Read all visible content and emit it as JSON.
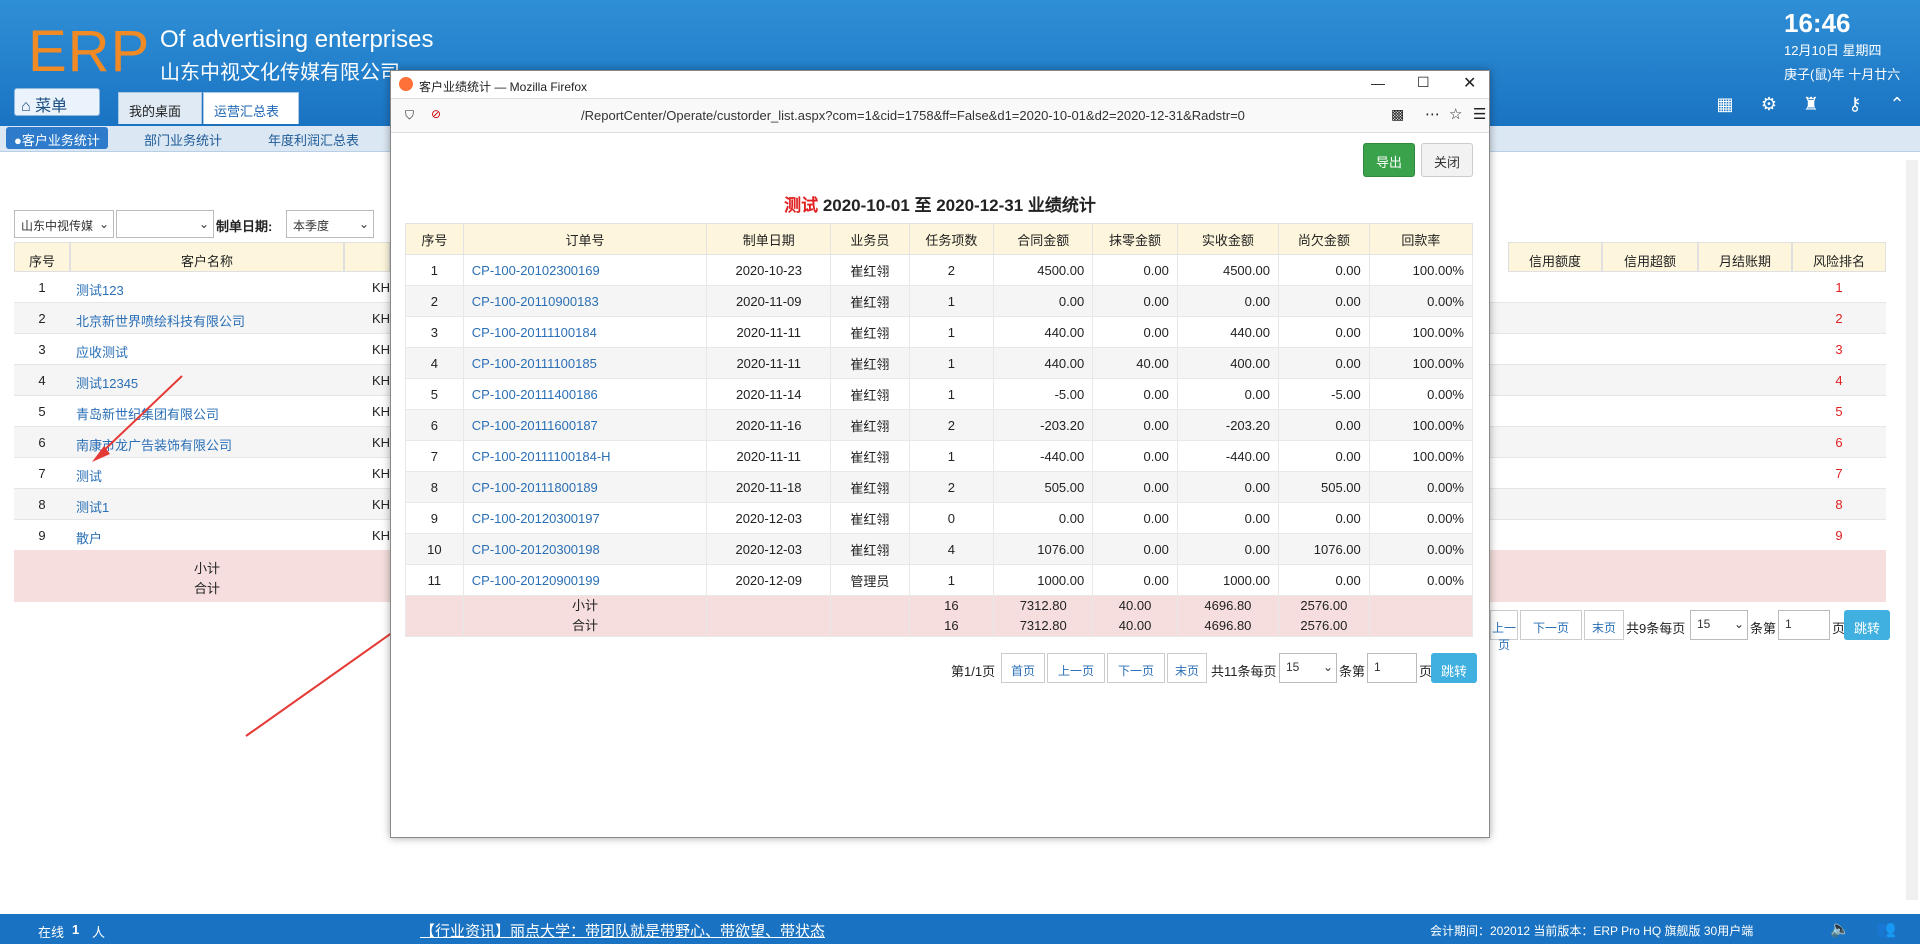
{
  "header": {
    "logo": "ERP",
    "tagline_en": "Of advertising enterprises",
    "company": "山东中视文化传媒有限公司",
    "time": "16:46",
    "date": "12月10日 星期四",
    "lunar": "庚子(鼠)年 十月廿六",
    "menu_label": "菜单",
    "tabs": [
      {
        "label": "我的桌面"
      },
      {
        "label": "运营汇总表",
        "close": "×"
      }
    ],
    "icons": [
      "grid-add-icon",
      "gear-icon",
      "shirt-icon",
      "key-icon",
      "chevron-up-icon"
    ]
  },
  "subtabs": [
    "●客户业务统计",
    "部门业务统计",
    "年度利润汇总表"
  ],
  "filter": {
    "company": "山东中视传媒",
    "date_label": "制单日期:",
    "period": "本季度"
  },
  "bg_table": {
    "headers": [
      "序号",
      "客户名称"
    ],
    "right_headers": [
      "信用额度",
      "信用超额",
      "月结账期",
      "风险排名"
    ],
    "rows": [
      {
        "no": "1",
        "name": "测试123",
        "code": "KH",
        "rank": "1"
      },
      {
        "no": "2",
        "name": "北京新世界喷绘科技有限公司",
        "code": "KH",
        "rank": "2"
      },
      {
        "no": "3",
        "name": "应收测试",
        "code": "KH",
        "rank": "3"
      },
      {
        "no": "4",
        "name": "测试12345",
        "code": "KH",
        "rank": "4"
      },
      {
        "no": "5",
        "name": "青岛新世纪集团有限公司",
        "code": "KH",
        "rank": "5"
      },
      {
        "no": "6",
        "name": "南康市龙广告装饰有限公司",
        "code": "KH",
        "rank": "6"
      },
      {
        "no": "7",
        "name": "测试",
        "code": "KH",
        "rank": "7"
      },
      {
        "no": "8",
        "name": "测试1",
        "code": "KH",
        "rank": "8"
      },
      {
        "no": "9",
        "name": "散户",
        "code": "KH",
        "rank": "9"
      }
    ],
    "subtotal": "小计",
    "total": "合计",
    "pager": {
      "prev": "上一页",
      "next": "下一页",
      "last": "末页",
      "count": "共9条每页",
      "size": "15",
      "page_label": "条第",
      "page": "1",
      "unit": "页",
      "go": "跳转"
    }
  },
  "modal": {
    "window_title": "客户业绩统计 — Mozilla Firefox",
    "url": "/ReportCenter/Operate/custorder_list.aspx?com=1&cid=1758&ff=False&d1=2020-10-01&d2=2020-12-31&Radstr=0",
    "export_label": "导出",
    "close_label": "关闭",
    "report_name": "测试",
    "report_range": "2020-10-01 至 2020-12-31 业绩统计",
    "headers": [
      "序号",
      "订单号",
      "制单日期",
      "业务员",
      "任务项数",
      "合同金额",
      "抹零金额",
      "实收金额",
      "尚欠金额",
      "回款率"
    ],
    "rows": [
      [
        "1",
        "CP-100-20102300169",
        "2020-10-23",
        "崔红翎",
        "2",
        "4500.00",
        "0.00",
        "4500.00",
        "0.00",
        "100.00%"
      ],
      [
        "2",
        "CP-100-20110900183",
        "2020-11-09",
        "崔红翎",
        "1",
        "0.00",
        "0.00",
        "0.00",
        "0.00",
        "0.00%"
      ],
      [
        "3",
        "CP-100-20111100184",
        "2020-11-11",
        "崔红翎",
        "1",
        "440.00",
        "0.00",
        "440.00",
        "0.00",
        "100.00%"
      ],
      [
        "4",
        "CP-100-20111100185",
        "2020-11-11",
        "崔红翎",
        "1",
        "440.00",
        "40.00",
        "400.00",
        "0.00",
        "100.00%"
      ],
      [
        "5",
        "CP-100-20111400186",
        "2020-11-14",
        "崔红翎",
        "1",
        "-5.00",
        "0.00",
        "0.00",
        "-5.00",
        "0.00%"
      ],
      [
        "6",
        "CP-100-20111600187",
        "2020-11-16",
        "崔红翎",
        "2",
        "-203.20",
        "0.00",
        "-203.20",
        "0.00",
        "100.00%"
      ],
      [
        "7",
        "CP-100-20111100184-H",
        "2020-11-11",
        "崔红翎",
        "1",
        "-440.00",
        "0.00",
        "-440.00",
        "0.00",
        "100.00%"
      ],
      [
        "8",
        "CP-100-20111800189",
        "2020-11-18",
        "崔红翎",
        "2",
        "505.00",
        "0.00",
        "0.00",
        "505.00",
        "0.00%"
      ],
      [
        "9",
        "CP-100-20120300197",
        "2020-12-03",
        "崔红翎",
        "0",
        "0.00",
        "0.00",
        "0.00",
        "0.00",
        "0.00%"
      ],
      [
        "10",
        "CP-100-20120300198",
        "2020-12-03",
        "崔红翎",
        "4",
        "1076.00",
        "0.00",
        "0.00",
        "1076.00",
        "0.00%"
      ],
      [
        "11",
        "CP-100-20120900199",
        "2020-12-09",
        "管理员",
        "1",
        "1000.00",
        "0.00",
        "1000.00",
        "0.00",
        "0.00%"
      ]
    ],
    "subtotal": {
      "label": "小计",
      "tasks": "16",
      "contract": "7312.80",
      "rounding": "40.00",
      "received": "4696.80",
      "owed": "2576.00"
    },
    "total": {
      "label": "合计",
      "tasks": "16",
      "contract": "7312.80",
      "rounding": "40.00",
      "received": "4696.80",
      "owed": "2576.00"
    },
    "pager": {
      "page_info": "第1/1页",
      "first": "首页",
      "prev": "上一页",
      "next": "下一页",
      "last": "末页",
      "count": "共11条每页",
      "size": "15",
      "page_label": "条第",
      "page": "1",
      "unit": "页",
      "go": "跳转"
    }
  },
  "footer": {
    "online_label": "在线",
    "online_count": "1",
    "online_unit": "人",
    "news": "【行业资讯】丽点大学：带团队就是带野心、带欲望、带状态",
    "version": "会计期间：202012 当前版本：ERP Pro HQ 旗舰版 30用户端"
  },
  "colors": {
    "header_blue": "#1a73c2",
    "accent_green": "#3aa24a",
    "logo_orange": "#f08a24",
    "rank_red": "#e02020",
    "annotation_arrow": "#e53935"
  }
}
